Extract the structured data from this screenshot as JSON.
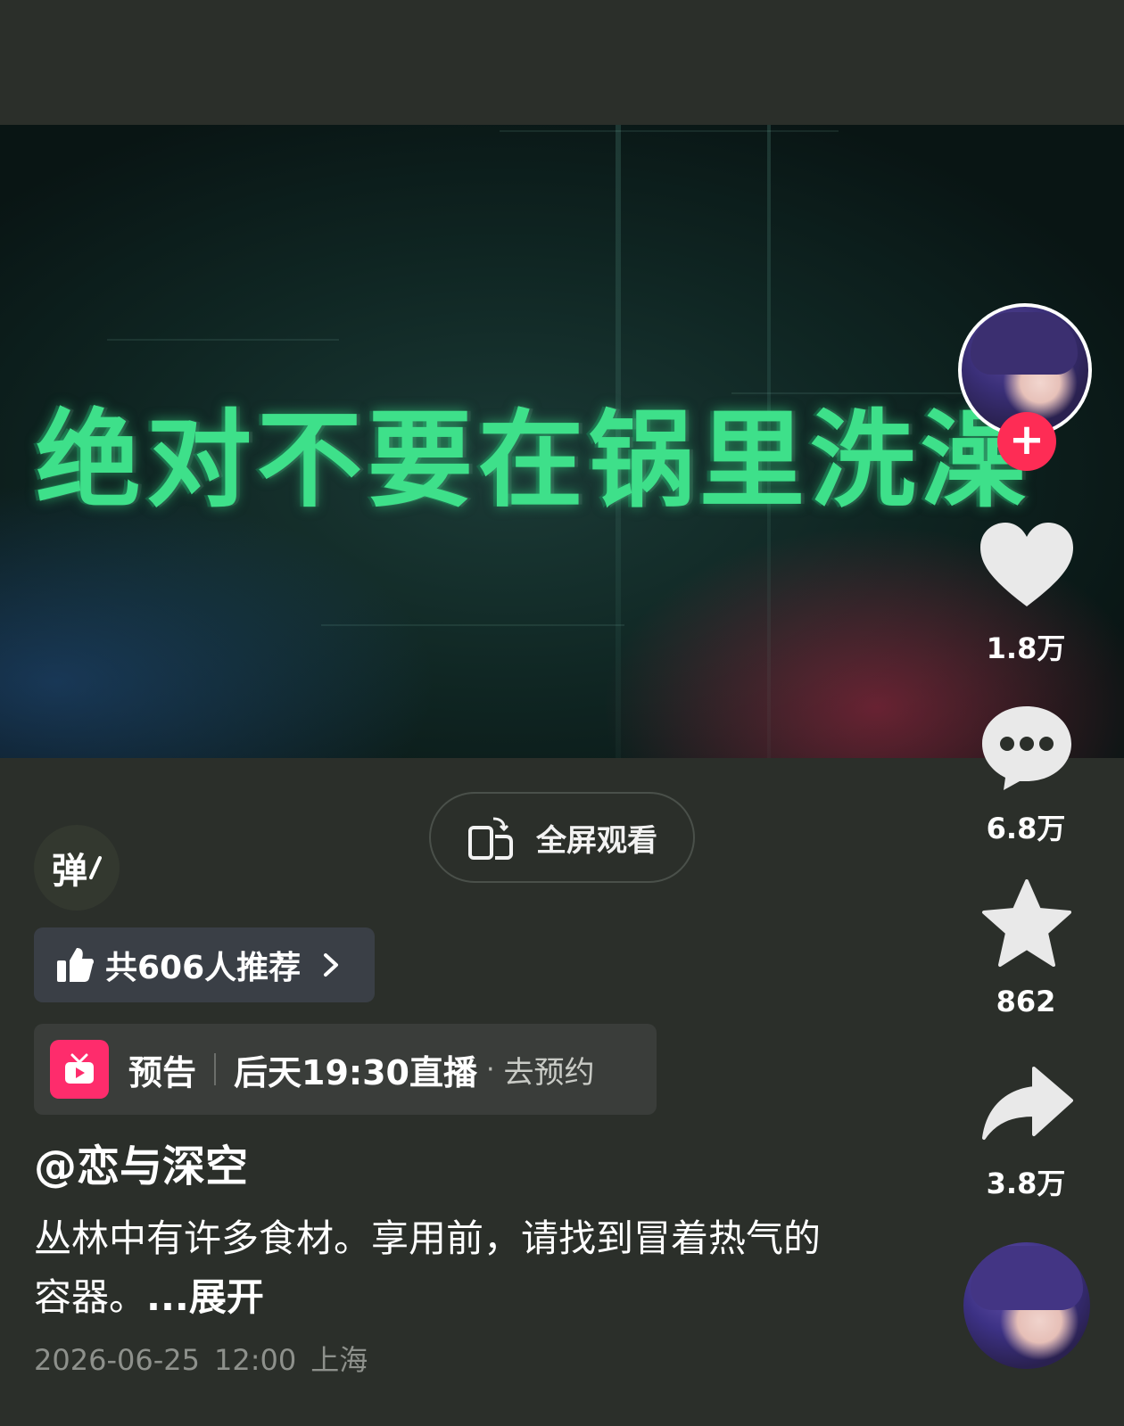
{
  "video": {
    "overlay_text": "绝对不要在锅里洗澡"
  },
  "fullscreen": {
    "label": "全屏观看",
    "icon": "rotate-screen-icon"
  },
  "danmaku": {
    "label": "弹"
  },
  "rail": {
    "like_count": "1.8万",
    "comment_count": "6.8万",
    "favorite_count": "862",
    "share_count": "3.8万",
    "follow_symbol": "+"
  },
  "recommend": {
    "label": "共606人推荐",
    "icon": "thumbs-up-icon"
  },
  "preview": {
    "tag": "预告",
    "time": "后天19:30直播",
    "separator": "·",
    "action": "去预约"
  },
  "author": {
    "handle": "@恋与深空"
  },
  "caption": {
    "text": "丛林中有许多食材。享用前，请找到冒着热气的容器。",
    "expand": "...展开"
  },
  "meta": {
    "date": "2026-06-25",
    "time": "12:00",
    "location": "上海"
  },
  "colors": {
    "background": "#2b2f2a",
    "accent": "#fe2c55",
    "overlay_text": "#3ee08a"
  }
}
